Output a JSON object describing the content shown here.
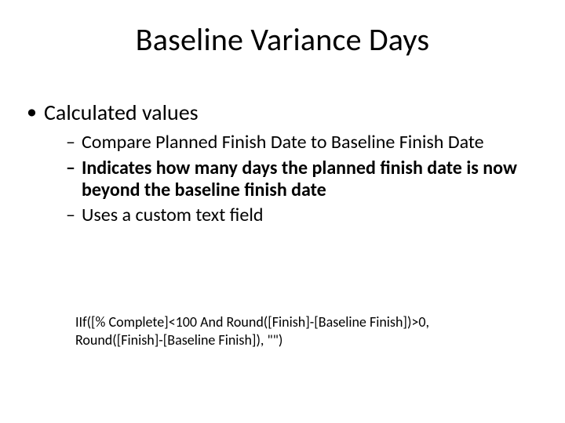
{
  "slide": {
    "title": "Baseline Variance Days",
    "bullet_level1": "Calculated values",
    "bullets_level2": {
      "b1": "Compare Planned Finish Date to Baseline Finish Date",
      "b2": "Indicates how many days the planned finish date is now beyond the baseline finish date",
      "b3": "Uses a custom text field"
    },
    "formula": "IIf([% Complete]<100 And Round([Finish]-[Baseline Finish])>0, Round([Finish]-[Baseline Finish]), \"\")"
  }
}
